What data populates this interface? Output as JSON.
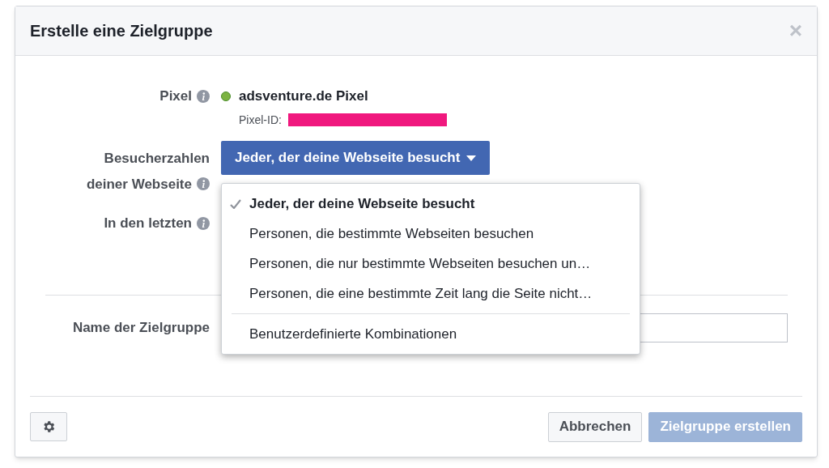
{
  "dialog": {
    "title": "Erstelle eine Zielgruppe",
    "close": "×"
  },
  "pixel": {
    "label": "Pixel",
    "active": true,
    "name": "adsventure.de Pixel",
    "id_label": "Pixel-ID:",
    "id_redacted": true
  },
  "visitors": {
    "label_lines": [
      "Besucherzahlen",
      "deiner Webseite"
    ],
    "button": "Jeder, der deine Webseite besucht"
  },
  "period": {
    "label": "In den letzten"
  },
  "menu": {
    "groups": [
      [
        {
          "label": "Jeder, der deine Webseite besucht",
          "selected": true
        },
        {
          "label": "Personen, die bestimmte Webseiten besuchen",
          "selected": false
        },
        {
          "label": "Personen, die nur bestimmte Webseiten besuchen un…",
          "selected": false
        },
        {
          "label": "Personen, die eine bestimmte Zeit lang die Seite nicht…",
          "selected": false
        }
      ],
      [
        {
          "label": "Benutzerdefinierte Kombinationen",
          "selected": false
        }
      ]
    ]
  },
  "audience_name": {
    "label": "Name der Zielgruppe"
  },
  "footer": {
    "buttons": [
      {
        "label": "Abbrechen",
        "disabled": false
      },
      {
        "label": "Zielgruppe erstellen",
        "disabled": true
      }
    ]
  }
}
